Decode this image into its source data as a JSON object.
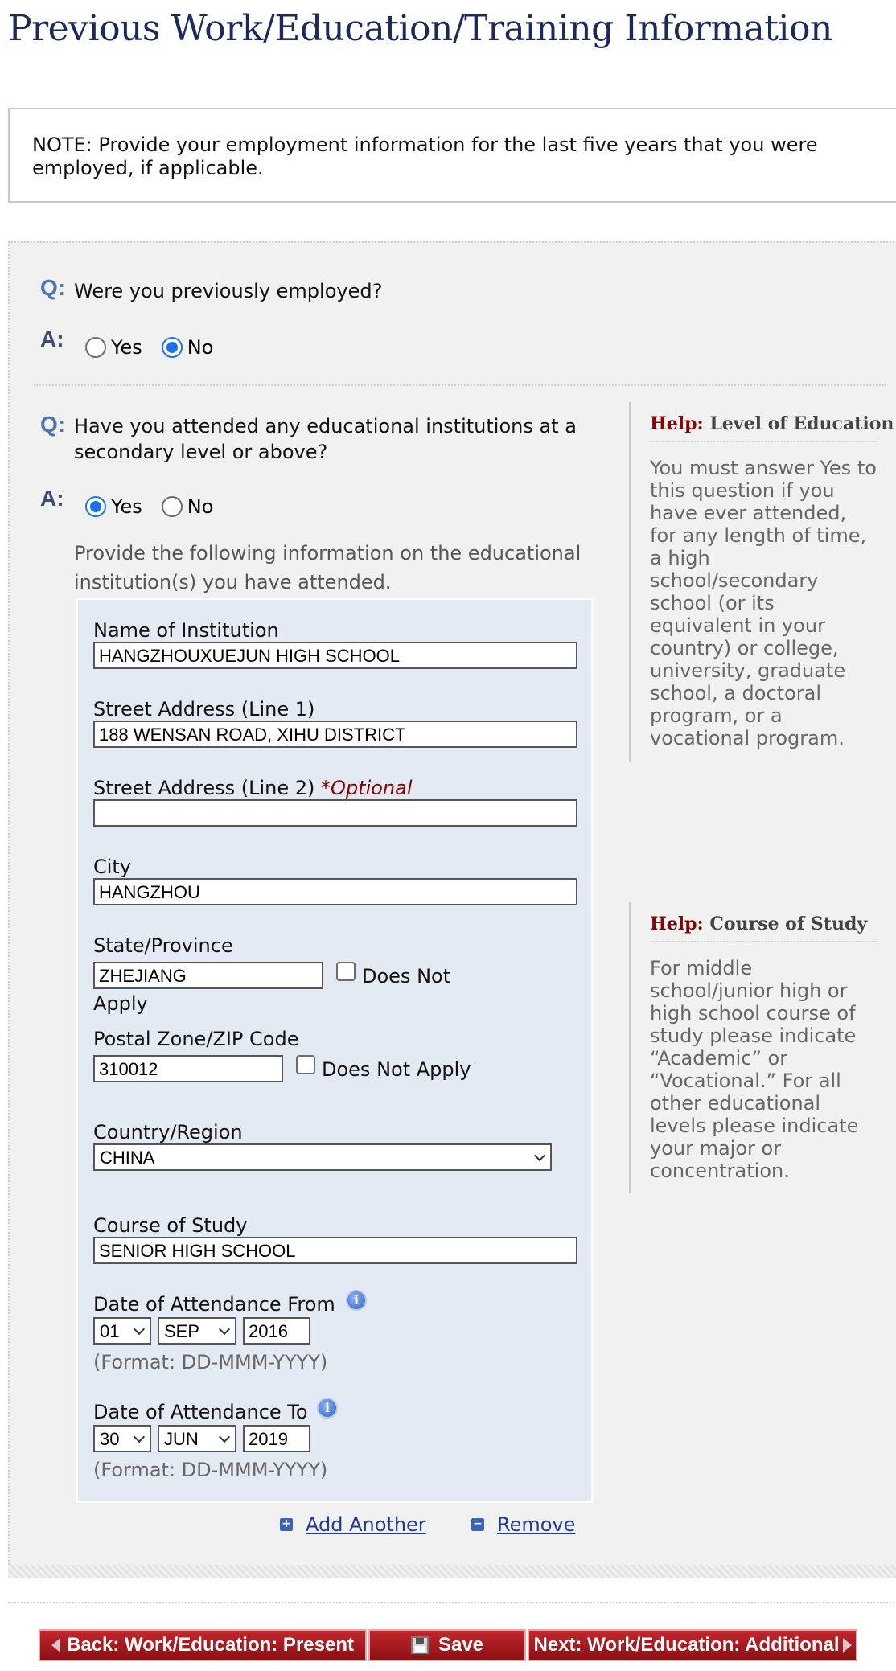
{
  "page": {
    "title": "Previous Work/Education/Training Information"
  },
  "note": {
    "text": "NOTE: Provide your employment information for the last five years that you were employed, if applicable."
  },
  "labels": {
    "q": "Q:",
    "a": "A:"
  },
  "question_employed": {
    "text": "Were you previously employed?",
    "options": [
      {
        "label": "Yes",
        "selected": false
      },
      {
        "label": "No",
        "selected": true
      }
    ]
  },
  "question_education": {
    "text": "Have you attended any educational institutions at a secondary level or above?",
    "options": [
      {
        "label": "Yes",
        "selected": true
      },
      {
        "label": "No",
        "selected": false
      }
    ],
    "instructions": "Provide the following information on the educational institution(s) you have attended."
  },
  "form": {
    "institution_label": "Name of Institution",
    "institution_value": "HANGZHOUXUEJUN HIGH SCHOOL",
    "street1_label": "Street Address (Line 1)",
    "street1_value": "188 WENSAN ROAD, XIHU DISTRICT",
    "street2_label": "Street Address (Line 2)",
    "street2_optional": "*Optional",
    "street2_value": "",
    "city_label": "City",
    "city_value": "HANGZHOU",
    "state_label": "State/Province",
    "state_value": "ZHEJIANG",
    "state_dna_line1": "Does Not",
    "state_dna_line2": "Apply",
    "postal_label": "Postal Zone/ZIP Code",
    "postal_value": "310012",
    "postal_dna": "Does Not Apply",
    "country_label": "Country/Region",
    "country_value": "CHINA",
    "course_label": "Course of Study",
    "course_value": "SENIOR HIGH SCHOOL",
    "from_label": "Date of Attendance From",
    "from_day": "01",
    "from_month": "SEP",
    "from_year": "2016",
    "from_format": "(Format: DD-MMM-YYYY)",
    "to_label": "Date of Attendance To",
    "to_day": "30",
    "to_month": "JUN",
    "to_year": "2019",
    "to_format": "(Format: DD-MMM-YYYY)",
    "info_icon_glyph": "i"
  },
  "actions": {
    "add_label": "Add Another",
    "remove_label": "Remove",
    "add_icon": "+",
    "remove_icon": "−"
  },
  "help_level": {
    "help_word": "Help:",
    "title": "Level of Education",
    "body": "You must answer Yes to this question if you have ever attended, for any length of time, a high school/secondary school (or its equivalent in your country) or college, university, graduate school, a doctoral program, or a vocational program."
  },
  "help_course": {
    "help_word": "Help:",
    "title": "Course of Study",
    "body": "For middle school/junior high or high school course of study please indicate “Academic” or “Vocational.” For all other educational levels please indicate your major or concentration."
  },
  "footer": {
    "back_label": "Back: Work/Education: Present",
    "save_label": "Save",
    "next_label": "Next: Work/Education: Additional"
  },
  "colors": {
    "title": "#1c2a5b",
    "panel_bg": "#f1f1f1",
    "form_bg": "#e3eaf3",
    "help_accent": "#8b0000",
    "button_red": "#a8161c",
    "radio_blue": "#1a73e8"
  }
}
